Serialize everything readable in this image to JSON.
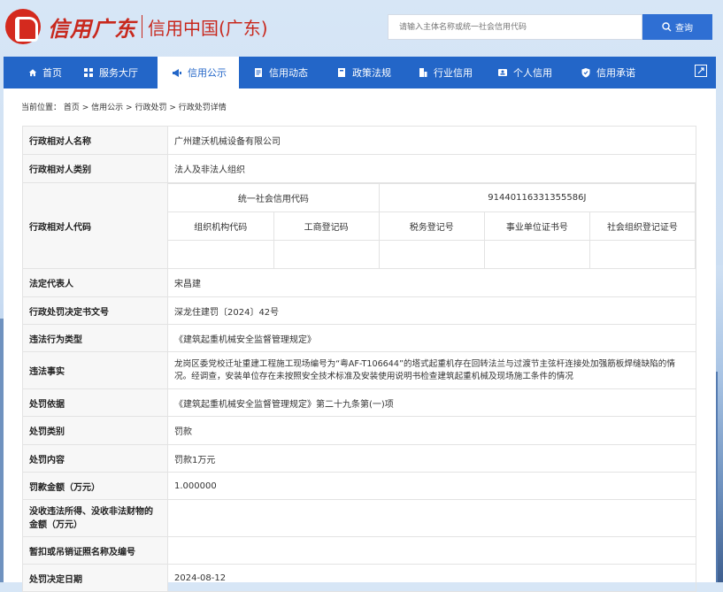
{
  "header": {
    "logo_text": "信用广东",
    "logo_sub": "信用中国(广东)",
    "search_placeholder": "请输入主体名称或统一社会信用代码",
    "search_button": "查询"
  },
  "nav": {
    "items": [
      {
        "label": "首页",
        "icon": "home-icon"
      },
      {
        "label": "服务大厅",
        "icon": "grid-icon"
      },
      {
        "label": "信用公示",
        "icon": "megaphone-icon"
      },
      {
        "label": "信用动态",
        "icon": "document-icon"
      },
      {
        "label": "政策法规",
        "icon": "book-icon"
      },
      {
        "label": "行业信用",
        "icon": "building-icon"
      },
      {
        "label": "个人信用",
        "icon": "id-card-icon"
      },
      {
        "label": "信用承诺",
        "icon": "shield-icon"
      }
    ],
    "active_index": 2
  },
  "breadcrumb": {
    "prefix": "当前位置：",
    "items": [
      "首页",
      "信用公示",
      "行政处罚",
      "行政处罚详情"
    ],
    "separator": " > "
  },
  "record": {
    "subject_name_label": "行政相对人名称",
    "subject_name": "广州建沃机械设备有限公司",
    "subject_type_label": "行政相对人类别",
    "subject_type": "法人及非法人组织",
    "subject_code_label": "行政相对人代码",
    "usc_code_label": "统一社会信用代码",
    "usc_code": "91440116331355586J",
    "code_headers": [
      "组织机构代码",
      "工商登记码",
      "税务登记号",
      "事业单位证书号",
      "社会组织登记证号"
    ],
    "legal_rep_label": "法定代表人",
    "legal_rep": "宋昌建",
    "decision_no_label": "行政处罚决定书文号",
    "decision_no": "深龙住建罚〔2024〕42号",
    "violation_type_label": "违法行为类型",
    "violation_type": "《建筑起重机械安全监督管理规定》",
    "facts_label": "违法事实",
    "facts": "龙岗区委党校迁址重建工程施工现场编号为“粤AF-T106644”的塔式起重机存在回转法兰与过渡节主弦杆连接处加强筋板焊缝缺陷的情况。经调查，安装单位存在未按照安全技术标准及安装使用说明书检查建筑起重机械及现场施工条件的情况",
    "basis_label": "处罚依据",
    "basis": "《建筑起重机械安全监督管理规定》第二十九条第(一)项",
    "category_label": "处罚类别",
    "category": "罚款",
    "content_label": "处罚内容",
    "content": "罚款1万元",
    "amount_label": "罚款金额（万元）",
    "amount": "1.000000",
    "confiscation_label": "没收违法所得、没收非法财物的金额（万元）",
    "confiscation": "",
    "license_label": "暂扣或吊销证照名称及编号",
    "license": "",
    "decision_date_label": "处罚决定日期",
    "decision_date": "2024-08-12"
  }
}
